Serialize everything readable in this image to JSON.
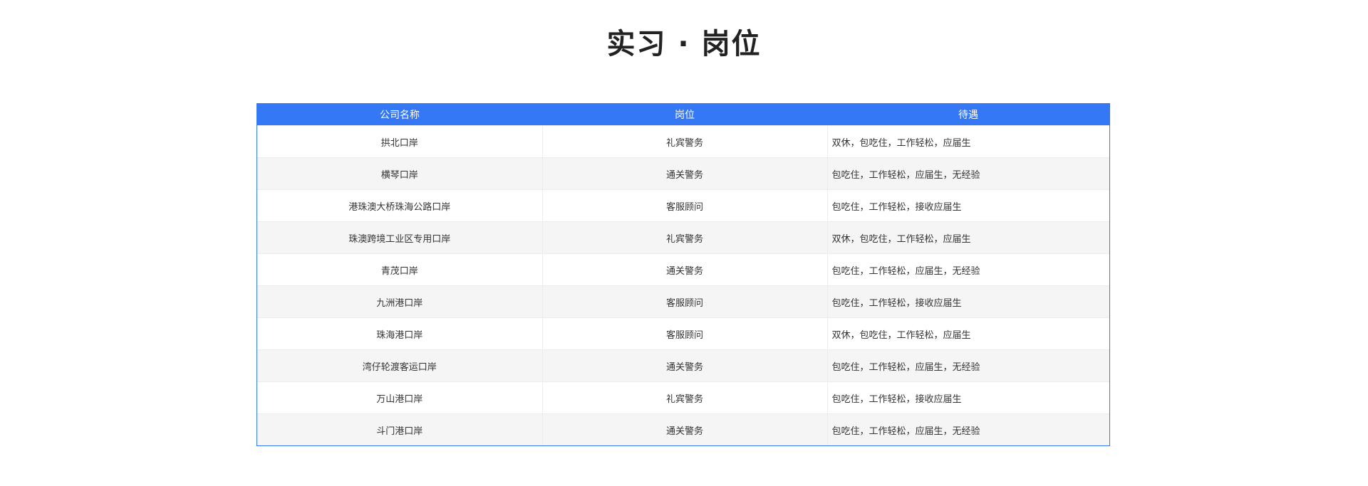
{
  "page": {
    "title": "实习 · 岗位"
  },
  "table": {
    "headers": [
      "公司名称",
      "岗位",
      "待遇"
    ],
    "rows": [
      [
        "拱北口岸",
        "礼宾警务",
        "双休，包吃住，工作轻松，应届生"
      ],
      [
        "横琴口岸",
        "通关警务",
        "包吃住，工作轻松，应届生，无经验"
      ],
      [
        "港珠澳大桥珠海公路口岸",
        "客服顾问",
        "包吃住，工作轻松，接收应届生"
      ],
      [
        "珠澳跨境工业区专用口岸",
        "礼宾警务",
        "双休，包吃住，工作轻松，应届生"
      ],
      [
        "青茂口岸",
        "通关警务",
        "包吃住，工作轻松，应届生，无经验"
      ],
      [
        "九洲港口岸",
        "客服顾问",
        "包吃住，工作轻松，接收应届生"
      ],
      [
        "珠海港口岸",
        "客服顾问",
        "双休，包吃住，工作轻松，应届生"
      ],
      [
        "湾仔轮渡客运口岸",
        "通关警务",
        "包吃住，工作轻松，应届生，无经验"
      ],
      [
        "万山港口岸",
        "礼宾警务",
        "包吃住，工作轻松，接收应届生"
      ],
      [
        "斗门港口岸",
        "通关警务",
        "包吃住，工作轻松，应届生，无经验"
      ]
    ]
  },
  "colors": {
    "header_bg": "#3478f6",
    "header_text": "#ffffff",
    "row_alt_bg": "#f5f5f5"
  }
}
